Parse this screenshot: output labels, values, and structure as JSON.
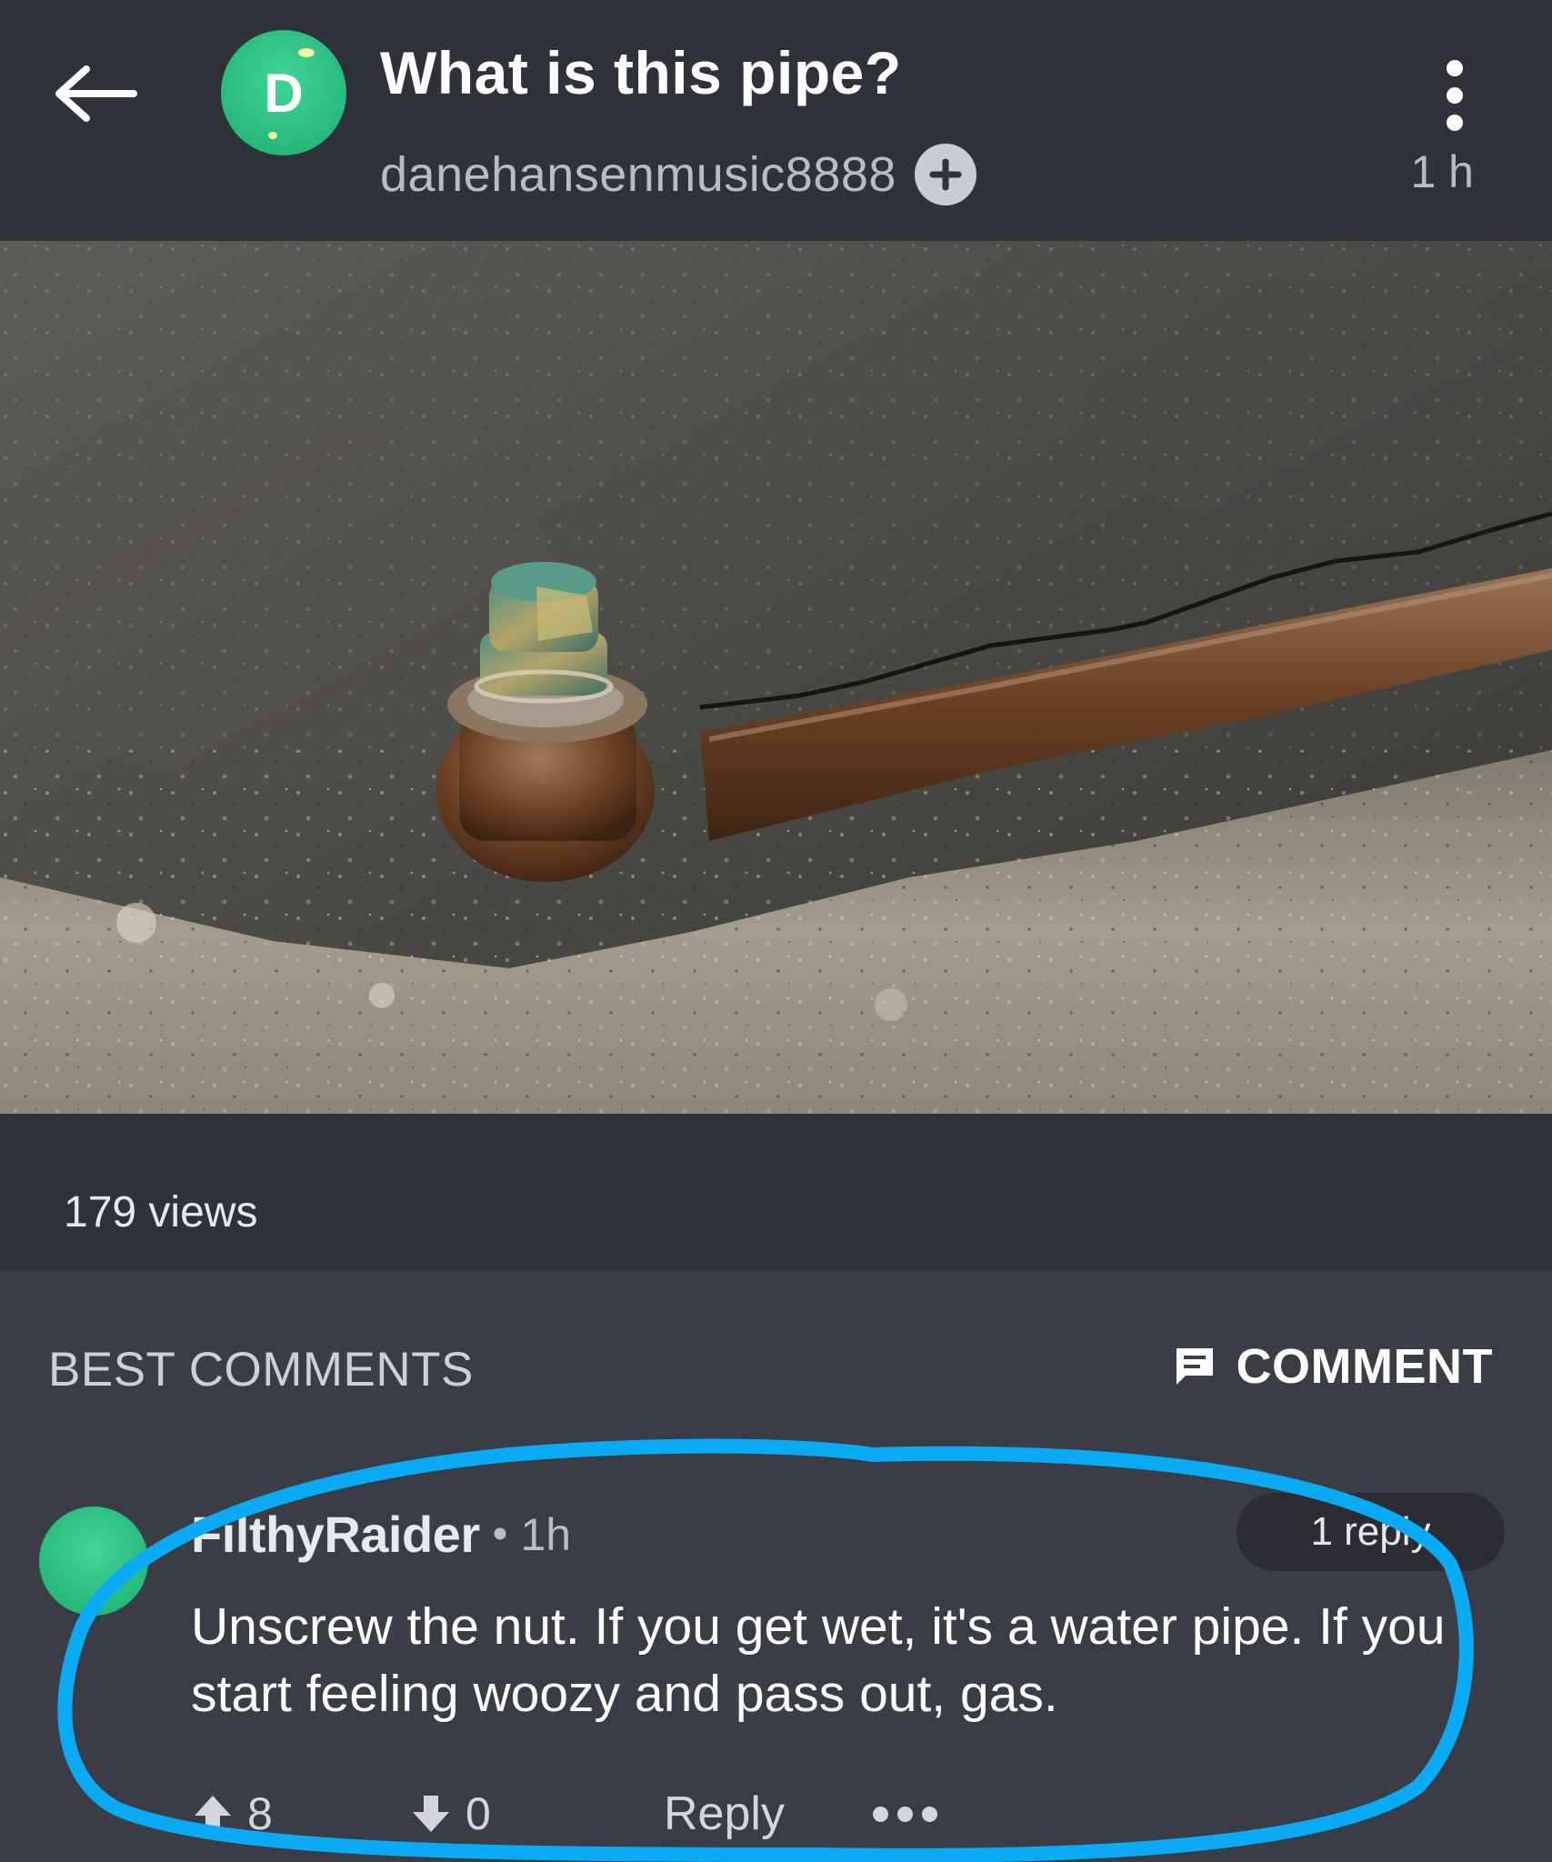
{
  "post": {
    "title": "What is this pipe?",
    "avatar_letter": "D",
    "username": "danehansenmusic8888",
    "time": "1 h",
    "views": "179 views"
  },
  "icons": {
    "back": "arrow-left-icon",
    "follow": "plus-icon",
    "more": "more-vertical-icon",
    "comment": "comment-icon",
    "upvote": "arrow-up-icon",
    "downvote": "arrow-down-icon",
    "options": "more-horizontal-icon"
  },
  "comments": {
    "header": "BEST COMMENTS",
    "add_label": "COMMENT",
    "items": [
      {
        "user": "FilthyRaider",
        "separator": "•",
        "time": "1h",
        "replies": "1 reply",
        "text": "Unscrew the nut. If you get wet, it's a water pipe. If you start feeling woozy and pass out, gas.",
        "upvotes": "8",
        "downvotes": "0",
        "reply_label": "Reply"
      }
    ]
  },
  "colors": {
    "background": "#3a3d45",
    "header": "#2f3239",
    "avatar": "#27b97b",
    "highlight_stroke": "#0aaaf5"
  }
}
